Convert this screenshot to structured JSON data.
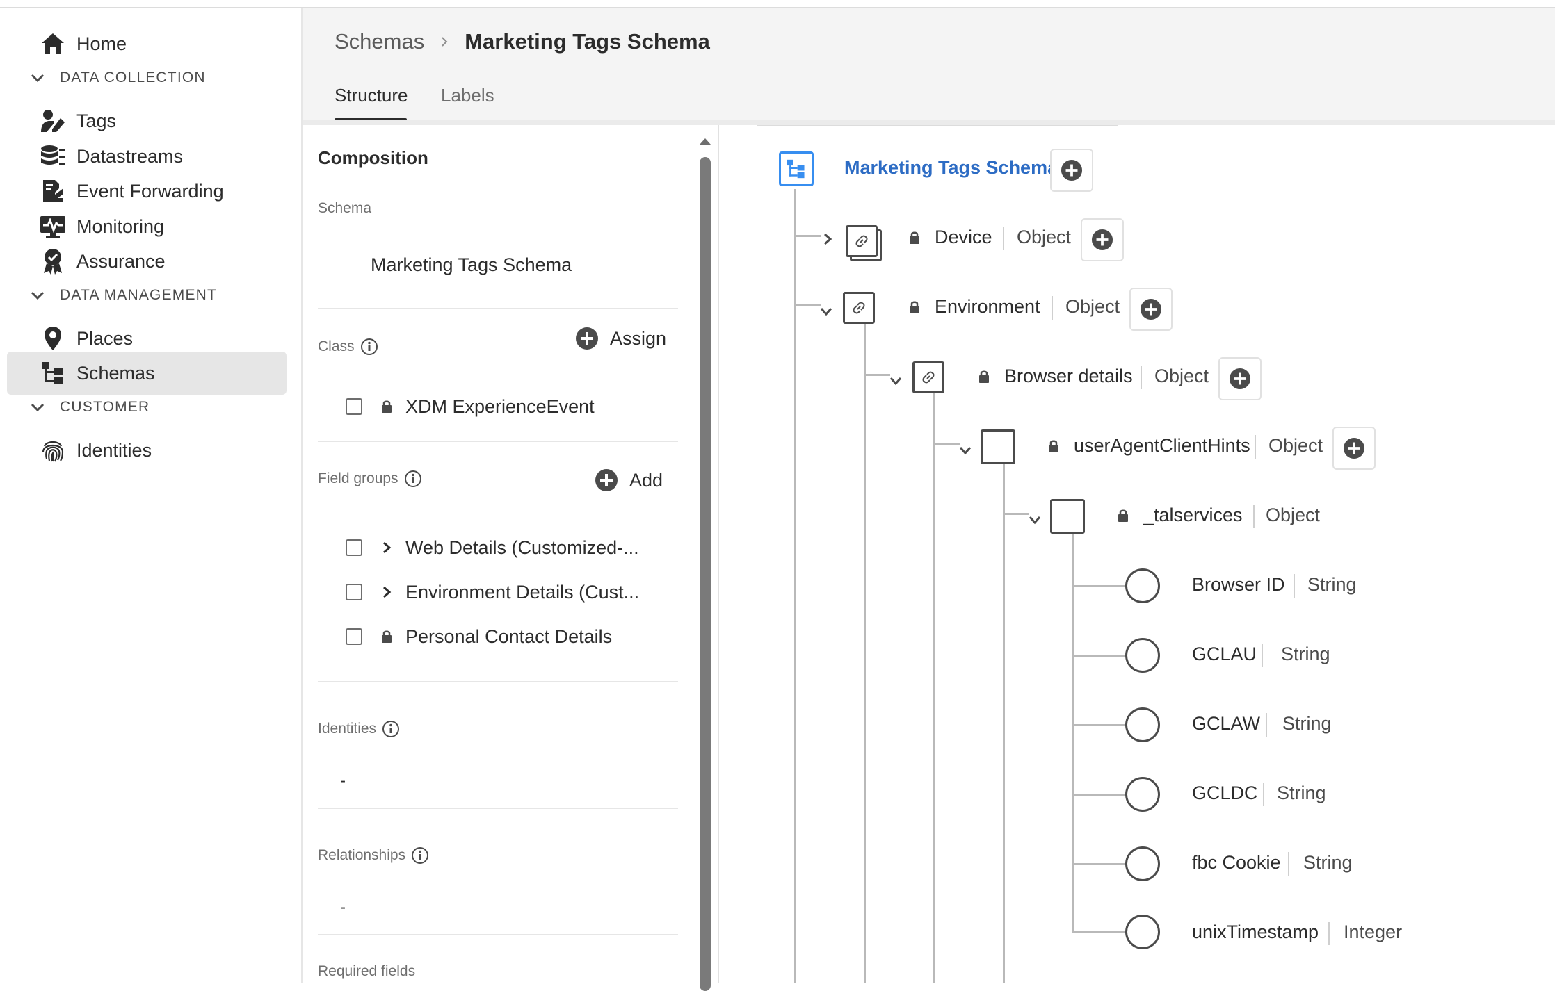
{
  "nav": {
    "home": "Home",
    "sections": [
      {
        "label": "DATA COLLECTION"
      },
      {
        "label": "DATA MANAGEMENT"
      },
      {
        "label": "CUSTOMER"
      }
    ],
    "items": [
      {
        "label": "Tags",
        "icon": "tags-icon"
      },
      {
        "label": "Datastreams",
        "icon": "datastreams-icon"
      },
      {
        "label": "Event Forwarding",
        "icon": "event-forwarding-icon"
      },
      {
        "label": "Monitoring",
        "icon": "monitoring-icon"
      },
      {
        "label": "Assurance",
        "icon": "assurance-icon"
      },
      {
        "label": "Places",
        "icon": "places-icon"
      },
      {
        "label": "Schemas",
        "icon": "schemas-icon",
        "selected": true
      },
      {
        "label": "Identities",
        "icon": "identities-icon"
      }
    ]
  },
  "header": {
    "breadcrumb_parent": "Schemas",
    "breadcrumb_current": "Marketing Tags Schema",
    "tabs": [
      {
        "label": "Structure",
        "active": true
      },
      {
        "label": "Labels",
        "active": false
      }
    ]
  },
  "composition": {
    "title": "Composition",
    "schema_label": "Schema",
    "schema_name": "Marketing Tags Schema",
    "class_label": "Class",
    "assign_label": "Assign",
    "class_value": "XDM ExperienceEvent",
    "field_groups_label": "Field groups",
    "add_label": "Add",
    "field_groups": [
      {
        "label": "Web Details (Customized-...",
        "glyph": "chevron-right"
      },
      {
        "label": "Environment Details (Cust...",
        "glyph": "chevron-right"
      },
      {
        "label": "Personal Contact Details",
        "glyph": "lock"
      }
    ],
    "identities_label": "Identities",
    "identities_value": "-",
    "relationships_label": "Relationships",
    "relationships_value": "-",
    "required_fields_label": "Required fields"
  },
  "tree": {
    "root": "Marketing Tags Schema",
    "nodes": [
      {
        "name": "Device",
        "type": "Object"
      },
      {
        "name": "Environment",
        "type": "Object"
      },
      {
        "name": "Browser details",
        "type": "Object"
      },
      {
        "name": "userAgentClientHints",
        "type": "Object"
      },
      {
        "name": "_talservices",
        "type": "Object"
      }
    ],
    "leaves": [
      {
        "name": "Browser ID",
        "type": "String"
      },
      {
        "name": "GCLAU",
        "type": "String"
      },
      {
        "name": "GCLAW",
        "type": "String"
      },
      {
        "name": "GCLDC",
        "type": "String"
      },
      {
        "name": "fbc Cookie",
        "type": "String"
      },
      {
        "name": "unixTimestamp",
        "type": "Integer"
      }
    ]
  },
  "colors": {
    "accent": "#2d6cc4",
    "root_border": "#378ef0",
    "selected_nav_bg": "#e6e6e6",
    "header_bg": "#f4f4f4"
  }
}
